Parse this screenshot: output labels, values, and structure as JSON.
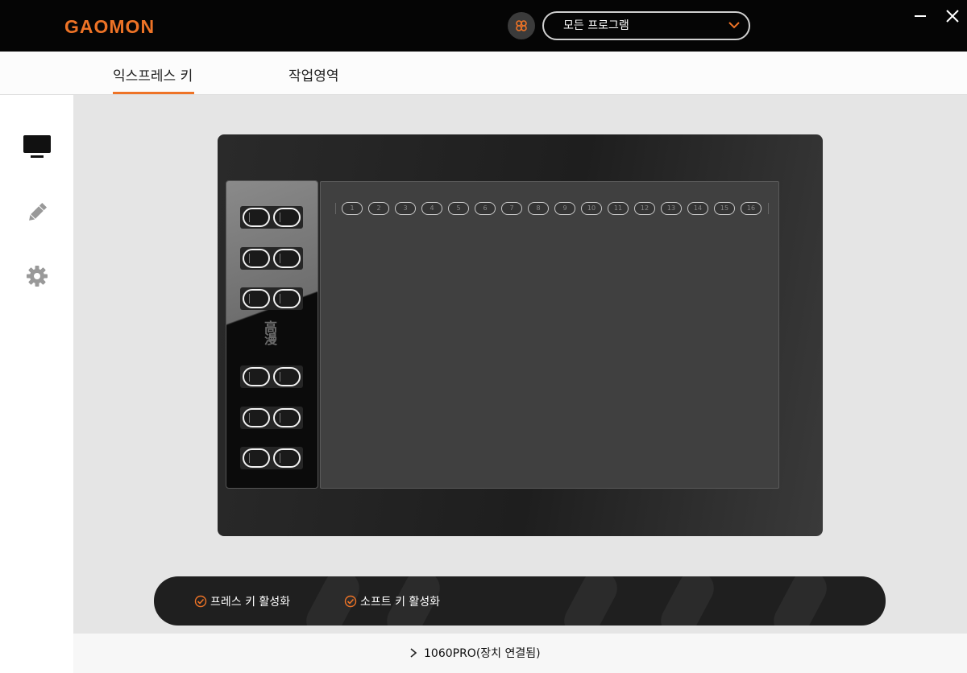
{
  "app": {
    "logo_text": "GAOMON",
    "brand_color": "#ee7326"
  },
  "header": {
    "program_icon": "flower-icon",
    "program_select": {
      "value": "모든 프로그램"
    },
    "minimize_icon": "minimize-icon",
    "close_icon": "close-icon"
  },
  "tabs": [
    {
      "label": "익스프레스 키",
      "active": true
    },
    {
      "label": "작업영역",
      "active": false
    }
  ],
  "sidebar": {
    "items": [
      {
        "icon": "monitor-icon",
        "active": true
      },
      {
        "icon": "pen-icon",
        "active": false
      },
      {
        "icon": "gear-icon",
        "active": false
      }
    ]
  },
  "tablet": {
    "vertical_brand_text": "高漫",
    "hotkeys": [
      "1",
      "2",
      "3",
      "4",
      "5",
      "6",
      "7",
      "8",
      "9",
      "10",
      "11",
      "12",
      "13",
      "14",
      "15",
      "16"
    ]
  },
  "activation": {
    "press_key_label": "프레스 키 활성화",
    "press_key_checked": true,
    "soft_key_label": "소프트 키 활성화",
    "soft_key_checked": true
  },
  "footer": {
    "device_label": "1060PRO(장치 연결됨)"
  }
}
